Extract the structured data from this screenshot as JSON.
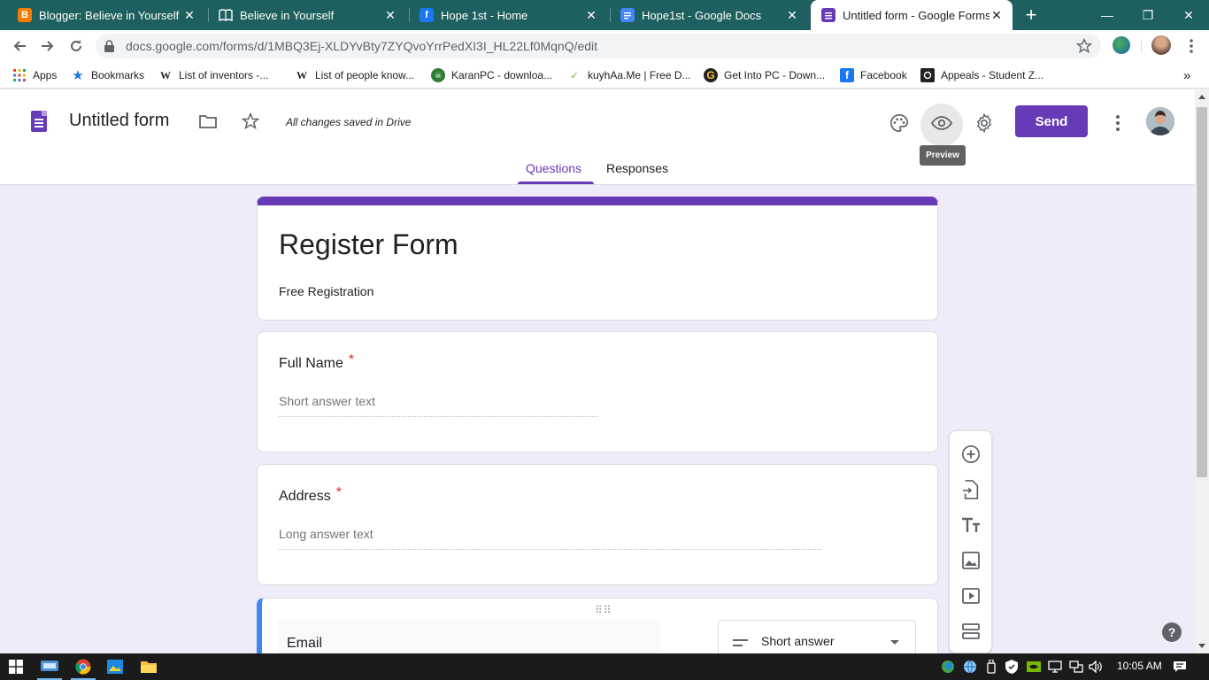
{
  "browser": {
    "tabs": [
      {
        "title": "Blogger: Believe in Yourself - A",
        "favicon": "blogger-icon",
        "color": "#f57d00"
      },
      {
        "title": "Believe in Yourself",
        "favicon": "book-icon",
        "color": "#ffffff"
      },
      {
        "title": "Hope 1st - Home",
        "favicon": "facebook-icon",
        "color": "#1877f2"
      },
      {
        "title": "Hope1st - Google Docs",
        "favicon": "docs-icon",
        "color": "#4285f4"
      },
      {
        "title": "Untitled form - Google Forms",
        "favicon": "forms-icon",
        "color": "#673ab7"
      }
    ],
    "active_tab": 4,
    "close_glyph": "✕",
    "new_tab_glyph": "+",
    "window_controls": {
      "minimize": "—",
      "restore": "❐",
      "close": "✕"
    },
    "url": "docs.google.com/forms/d/1MBQ3Ej-XLDYvBty7ZYQvoYrrPedXI3I_HL22Lf0MqnQ/edit"
  },
  "bookmarks": [
    {
      "label": "Apps",
      "icon": "apps-grid-icon"
    },
    {
      "label": "Bookmarks",
      "icon": "star-icon"
    },
    {
      "label": "List of inventors -...",
      "icon": "wikipedia-icon"
    },
    {
      "label": "List of people know...",
      "icon": "wikipedia-icon"
    },
    {
      "label": "KaranPC - downloa...",
      "icon": "karanpc-icon"
    },
    {
      "label": "kuyhAa.Me | Free D...",
      "icon": "kuyhaa-icon"
    },
    {
      "label": "Get Into PC - Down...",
      "icon": "getintopc-icon"
    },
    {
      "label": "Facebook",
      "icon": "facebook-icon"
    },
    {
      "label": "Appeals - Student Z...",
      "icon": "appeals-icon"
    }
  ],
  "bookmarks_overflow": "»",
  "forms_header": {
    "title": "Untitled form",
    "saved_status": "All changes saved in Drive",
    "send_label": "Send",
    "preview_tooltip": "Preview",
    "tabs": [
      "Questions",
      "Responses"
    ],
    "active_tab": 0,
    "accent_color": "#673ab7"
  },
  "form": {
    "title": "Register Form",
    "description": "Free Registration",
    "questions": [
      {
        "label": "Full Name",
        "required_mark": "*",
        "hint": "Short answer text"
      },
      {
        "label": "Address",
        "required_mark": "*",
        "hint": "Long answer text"
      }
    ],
    "active_question": {
      "label": "Email",
      "type_label": "Short answer",
      "drag_handle": "⠿⠿"
    }
  },
  "side_toolbar": [
    "add-question-icon",
    "import-questions-icon",
    "add-title-icon",
    "add-image-icon",
    "add-video-icon",
    "add-section-icon"
  ],
  "help_label": "?",
  "taskbar": {
    "clock": "10:05 AM"
  }
}
